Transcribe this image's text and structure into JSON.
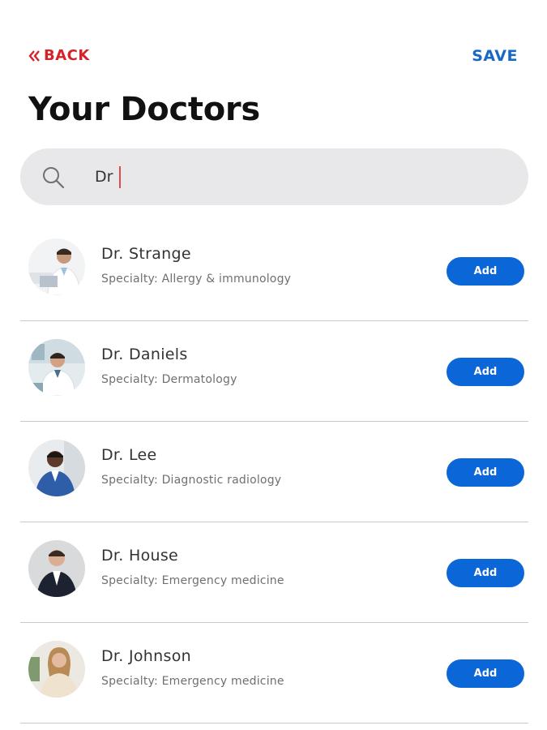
{
  "header": {
    "back_label": "BACK",
    "save_label": "SAVE"
  },
  "page": {
    "title": "Your Doctors"
  },
  "search": {
    "value": "Dr",
    "placeholder": ""
  },
  "doctors": [
    {
      "name": "Dr. Strange",
      "specialty": "Specialty: Allergy & immunology",
      "action": "Add"
    },
    {
      "name": "Dr. Daniels",
      "specialty": "Specialty: Dermatology",
      "action": "Add"
    },
    {
      "name": "Dr. Lee",
      "specialty": "Specialty: Diagnostic radiology",
      "action": "Add"
    },
    {
      "name": "Dr. House",
      "specialty": "Specialty: Emergency medicine",
      "action": "Add"
    },
    {
      "name": "Dr. Johnson",
      "specialty": "Specialty: Emergency medicine",
      "action": "Add"
    }
  ],
  "icons": {
    "back": "double-chevron-left-icon",
    "search": "search-icon"
  },
  "colors": {
    "back": "#d3232b",
    "save": "#1768c9",
    "add_button": "#0b66d8",
    "search_bg": "#e8e8ea"
  }
}
